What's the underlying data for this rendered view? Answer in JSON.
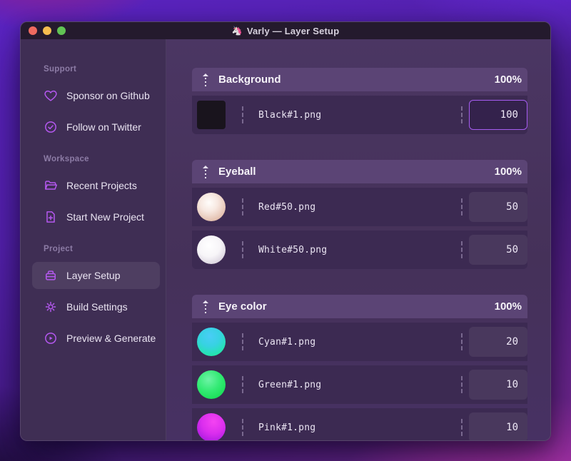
{
  "window": {
    "title": "Varly — Layer Setup",
    "title_icon": "🦄",
    "traffic_lights": [
      {
        "name": "close-button",
        "color": "#ee6a5f"
      },
      {
        "name": "minimize-button",
        "color": "#f5bd4f"
      },
      {
        "name": "zoom-button",
        "color": "#61c354"
      }
    ]
  },
  "sidebar": {
    "sections": [
      {
        "label": "Support",
        "items": [
          {
            "label": "Sponsor on Github",
            "icon": "heart-icon",
            "active": false
          },
          {
            "label": "Follow on Twitter",
            "icon": "check-badge-icon",
            "active": false
          }
        ]
      },
      {
        "label": "Workspace",
        "items": [
          {
            "label": "Recent Projects",
            "icon": "folder-icon",
            "active": false
          },
          {
            "label": "Start New Project",
            "icon": "file-plus-icon",
            "active": false
          }
        ]
      },
      {
        "label": "Project",
        "items": [
          {
            "label": "Layer Setup",
            "icon": "layers-icon",
            "active": true
          },
          {
            "label": "Build Settings",
            "icon": "gear-icon",
            "active": false
          },
          {
            "label": "Preview & Generate",
            "icon": "play-circle-icon",
            "active": false
          }
        ]
      }
    ]
  },
  "layer_groups": [
    {
      "name": "Background",
      "weight": "100%",
      "items": [
        {
          "file": "Black#1.png",
          "value": "100",
          "thumb": "black-square",
          "focused": true
        }
      ]
    },
    {
      "name": "Eyeball",
      "weight": "100%",
      "items": [
        {
          "file": "Red#50.png",
          "value": "50",
          "thumb": "red-sphere",
          "focused": false
        },
        {
          "file": "White#50.png",
          "value": "50",
          "thumb": "white-sphere",
          "focused": false
        }
      ]
    },
    {
      "name": "Eye color",
      "weight": "100%",
      "items": [
        {
          "file": "Cyan#1.png",
          "value": "20",
          "thumb": "cyan-sphere",
          "focused": false
        },
        {
          "file": "Green#1.png",
          "value": "10",
          "thumb": "green-sphere",
          "focused": false
        },
        {
          "file": "Pink#1.png",
          "value": "10",
          "thumb": "pink-sphere",
          "focused": false
        }
      ]
    }
  ],
  "colors": {
    "accent": "#a55cf0",
    "sidebar_icon": "#b558f0",
    "group_header_bg": "#5b4475",
    "row_bg": "#3c2a52",
    "sidebar_bg": "#3f2e54",
    "titlebar_bg": "#241a2d"
  }
}
